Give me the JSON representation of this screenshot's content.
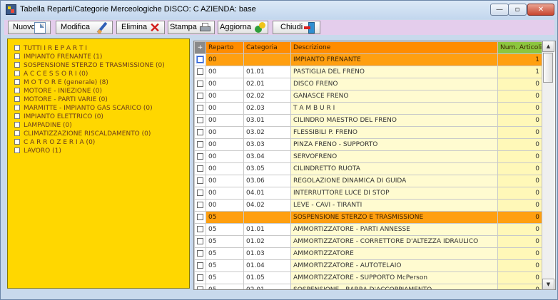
{
  "window": {
    "title": "Tabella  Reparti/Categorie Merceologiche    DISCO: C    AZIENDA: base",
    "controls": {
      "minimize": "—",
      "maximize": "▫",
      "close": "✕"
    }
  },
  "toolbar": {
    "new_label": "Nuovo",
    "edit_label": "Modifica",
    "delete_label": "Elimina",
    "delete_icon": "✕",
    "print_label": "Stampa",
    "refresh_label": "Aggiorna",
    "close_label": "Chiudi"
  },
  "categories": [
    "TUTTI I R E P A R T I",
    "IMPIANTO FRENANTE (1)",
    "SOSPENSIONE STERZO E TRASMISSIONE (0)",
    "A C C E S S O R I (0)",
    "M O T O R E (generale) (8)",
    "MOTORE - INIEZIONE (0)",
    "MOTORE - PARTI VARIE (0)",
    "MARMITTE - IMPIANTO GAS SCARICO (0)",
    "IMPIANTO ELETTRICO (0)",
    "LAMPADINE (0)",
    "CLIMATIZZAZIONE RISCALDAMENTO (0)",
    "C A R R O Z E R I A (0)",
    "LAVORO (1)"
  ],
  "table": {
    "headers": {
      "sel": "+",
      "reparto": "Reparto",
      "categoria": "Categoria",
      "descrizione": "Descrizione",
      "num": "Num. Articoli"
    },
    "rows": [
      {
        "r": "00",
        "c": "",
        "d": "IMPIANTO FRENANTE",
        "n": "1",
        "type": "cat"
      },
      {
        "r": "00",
        "c": "01.01",
        "d": "PASTIGLIA DEL FRENO",
        "n": "1",
        "type": "sub"
      },
      {
        "r": "00",
        "c": "02.01",
        "d": "DISCO FRENO",
        "n": "0",
        "type": "sub"
      },
      {
        "r": "00",
        "c": "02.02",
        "d": "GANASCE FRENO",
        "n": "0",
        "type": "sub"
      },
      {
        "r": "00",
        "c": "02.03",
        "d": "T A M B U R I",
        "n": "0",
        "type": "sub"
      },
      {
        "r": "00",
        "c": "03.01",
        "d": "CILINDRO MAESTRO DEL FRENO",
        "n": "0",
        "type": "sub"
      },
      {
        "r": "00",
        "c": "03.02",
        "d": "FLESSIBILI P. FRENO",
        "n": "0",
        "type": "sub"
      },
      {
        "r": "00",
        "c": "03.03",
        "d": "PINZA FRENO - SUPPORTO",
        "n": "0",
        "type": "sub"
      },
      {
        "r": "00",
        "c": "03.04",
        "d": "SERVOFRENO",
        "n": "0",
        "type": "sub"
      },
      {
        "r": "00",
        "c": "03.05",
        "d": "CILINDRETTO RUOTA",
        "n": "0",
        "type": "sub"
      },
      {
        "r": "00",
        "c": "03.06",
        "d": "REGOLAZIONE DINAMICA DI GUIDA",
        "n": "0",
        "type": "sub"
      },
      {
        "r": "00",
        "c": "04.01",
        "d": "INTERRUTTORE LUCE DI STOP",
        "n": "0",
        "type": "sub"
      },
      {
        "r": "00",
        "c": "04.02",
        "d": "LEVE - CAVI - TIRANTI",
        "n": "0",
        "type": "sub"
      },
      {
        "r": "05",
        "c": "",
        "d": "SOSPENSIONE STERZO E TRASMISSIONE",
        "n": "0",
        "type": "cat"
      },
      {
        "r": "05",
        "c": "01.01",
        "d": "AMMORTIZZATORE - PARTI ANNESSE",
        "n": "0",
        "type": "sub"
      },
      {
        "r": "05",
        "c": "01.02",
        "d": "AMMORTIZZATORE - CORRETTORE D'ALTEZZA IDRAULICO",
        "n": "0",
        "type": "sub"
      },
      {
        "r": "05",
        "c": "01.03",
        "d": "AMMORTIZZATORE",
        "n": "0",
        "type": "sub"
      },
      {
        "r": "05",
        "c": "01.04",
        "d": "AMMORTIZZATORE - AUTOTELAIO",
        "n": "0",
        "type": "sub"
      },
      {
        "r": "05",
        "c": "01.05",
        "d": "AMMORTIZZATORE - SUPPORTO McPerson",
        "n": "0",
        "type": "sub"
      },
      {
        "r": "05",
        "c": "02.01",
        "d": "SOSPENSIONE - BARRA D'ACCOPPIAMENTO",
        "n": "0",
        "type": "sub"
      }
    ]
  },
  "scrollbar": {
    "up": "▲",
    "down": "▼"
  }
}
